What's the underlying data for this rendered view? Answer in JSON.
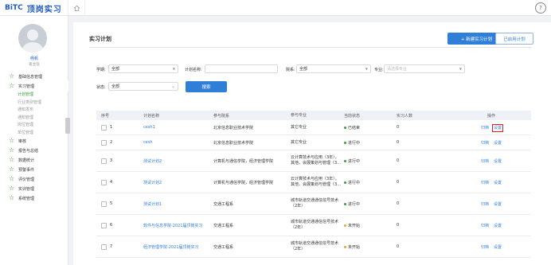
{
  "brand": {
    "mark": "BiTC",
    "name": "顶岗实习"
  },
  "user": {
    "name": "杨帆",
    "role": "班主任"
  },
  "sidebar": {
    "items": [
      {
        "label": "基础信息管理"
      },
      {
        "label": "实习管理",
        "children": [
          "计划管理",
          "行业类别管理",
          "通知发布",
          "通知管理",
          "岗位管理",
          "单位管理"
        ],
        "active_child": 0
      },
      {
        "label": "审核"
      },
      {
        "label": "报告与总结"
      },
      {
        "label": "数据统计"
      },
      {
        "label": "预警事件"
      },
      {
        "label": "评价管理"
      },
      {
        "label": "实训管理"
      },
      {
        "label": "系统管理"
      }
    ]
  },
  "page": {
    "title": "实习计划",
    "new_button": "+ 新建实习计划",
    "active_button": "已启用计划"
  },
  "filters": {
    "xueqi_label": "学期:",
    "xueqi_value": "全部",
    "plan_name_label": "计划名称:",
    "plan_name_value": "",
    "dept_label": "院系:",
    "dept_value": "全部",
    "major_label": "专业:",
    "major_placeholder": "请选择专业",
    "status_label": "状态:",
    "status_value": "全部",
    "search_button": "搜索"
  },
  "table": {
    "headers": [
      "序号",
      "计划名称",
      "参与院系",
      "参与专业",
      "当前状态",
      "实习人数",
      "操作"
    ],
    "rows": [
      {
        "no": "1",
        "name": "cesh1",
        "dept": "北京信息职业技术学院",
        "major": "其它专业",
        "status": "已结束",
        "status_color": "#3a9b3a",
        "count": "0",
        "ops": [
          "归档",
          "设置"
        ],
        "highlight": true
      },
      {
        "no": "2",
        "name": "cesh",
        "dept": "北京信息职业技术学院",
        "major": "其它专业",
        "status": "进行中",
        "status_color": "#3a9b3a",
        "count": "0",
        "ops": [
          "归档",
          "设置"
        ],
        "highlight": false
      },
      {
        "no": "3",
        "name": "测试计划2",
        "dept": "计算机与通信学院，经济管理学院",
        "major": "云计算技术与应用（3年），其他，会展策划与管理（3...",
        "status": "进行中",
        "status_color": "#3a9b3a",
        "count": "0",
        "ops": [
          "归档",
          "设置"
        ],
        "highlight": false
      },
      {
        "no": "4",
        "name": "测试计划2",
        "dept": "计算机与通信学院，经济管理学院",
        "major": "云计算技术与应用（3年），其他，会展策划与管理（3...",
        "status": "进行中",
        "status_color": "#3a9b3a",
        "count": "0",
        "ops": [
          "归档",
          "设置"
        ],
        "highlight": false
      },
      {
        "no": "5",
        "name": "测试计划1",
        "dept": "交通工程系",
        "major": "城市轨道交通通信信号技术（2年）",
        "status": "进行中",
        "status_color": "#3a9b3a",
        "count": "0",
        "ops": [
          "归档",
          "设置"
        ],
        "highlight": false
      },
      {
        "no": "6",
        "name": "软件与信息学院-2021届顶岗实习",
        "dept": "交通工程系",
        "major": "城市轨道交通通信信号技术（2年）",
        "status": "未开始",
        "status_color": "#e6a23c",
        "count": "0",
        "ops": [
          "归档",
          "设置"
        ],
        "highlight": false
      },
      {
        "no": "7",
        "name": "经济管理学院-2021届顶岗实习",
        "dept": "交通工程系",
        "major": "城市轨道交通通信信号技术（2年）",
        "status": "未开始",
        "status_color": "#e6a23c",
        "count": "0",
        "ops": [
          "归档",
          "设置"
        ],
        "highlight": false
      }
    ]
  }
}
